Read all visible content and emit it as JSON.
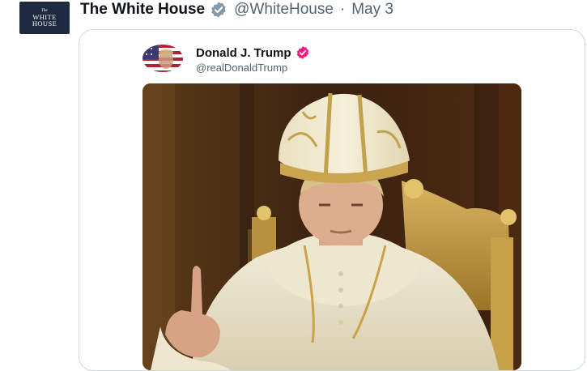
{
  "post": {
    "display_name": "The White House",
    "handle": "@WhiteHouse",
    "separator": "·",
    "date": "May 3",
    "verified_badge_color": "#829aab",
    "avatar": {
      "the": "The",
      "line1": "WHITE",
      "line2": "HOUSE",
      "color": "#1d2a3f"
    }
  },
  "quoted_post": {
    "display_name": "Donald J. Trump",
    "handle": "@realDonaldTrump",
    "verified_badge_color": "#f91880",
    "avatar_icon": "american-flag-portrait-icon",
    "media_description_icon": "portrait-image"
  },
  "colors": {
    "text_primary": "#0f1419",
    "text_secondary": "#536471",
    "card_border": "#cfd9de"
  }
}
